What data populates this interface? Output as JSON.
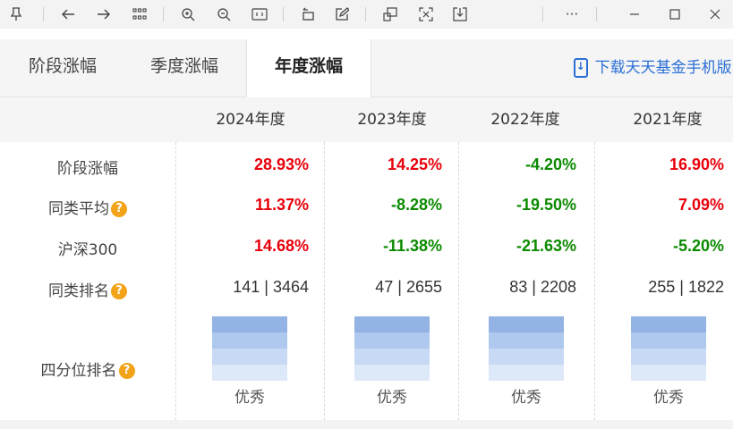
{
  "toolbar": {
    "icons": [
      "pin-icon",
      "back-icon",
      "forward-icon",
      "grid-icon",
      "zoom-in-icon",
      "zoom-out-icon",
      "fit-icon",
      "rotate-icon",
      "edit-icon",
      "window-icon",
      "crop-icon",
      "save-icon",
      "more-icon",
      "minimize-icon",
      "maximize-icon",
      "close-icon"
    ],
    "more": "···",
    "minimize": "—",
    "close": "✕"
  },
  "tabs": [
    {
      "label": "阶段涨幅",
      "active": false
    },
    {
      "label": "季度涨幅",
      "active": false
    },
    {
      "label": "年度涨幅",
      "active": true
    }
  ],
  "download_link": "下载天天基金手机版,",
  "columns": [
    "2024年度",
    "2023年度",
    "2022年度",
    "2021年度"
  ],
  "rows": [
    {
      "label": "阶段涨幅",
      "help": false,
      "values": [
        "28.93%",
        "14.25%",
        "-4.20%",
        "16.90%"
      ],
      "colors": [
        "#e8000b",
        "#e8000b",
        "#0b8a00",
        "#e8000b"
      ]
    },
    {
      "label": "同类平均",
      "help": true,
      "values": [
        "11.37%",
        "-8.28%",
        "-19.50%",
        "7.09%"
      ],
      "colors": [
        "#e8000b",
        "#0b8a00",
        "#0b8a00",
        "#e8000b"
      ]
    },
    {
      "label": "沪深300",
      "help": false,
      "values": [
        "14.68%",
        "-11.38%",
        "-21.63%",
        "-5.20%"
      ],
      "colors": [
        "#e8000b",
        "#0b8a00",
        "#0b8a00",
        "#0b8a00"
      ]
    },
    {
      "label": "同类排名",
      "help": true,
      "values": [
        "141 | 3464",
        "47 | 2655",
        "83 | 2208",
        "255 | 1822"
      ]
    }
  ],
  "quartile": {
    "label": "四分位排名",
    "values": [
      "优秀",
      "优秀",
      "优秀",
      "优秀"
    ]
  },
  "colors": {
    "up": "#e8000b",
    "down": "#0b8a00",
    "link": "#2b6fd6",
    "help": "#f2a318"
  }
}
